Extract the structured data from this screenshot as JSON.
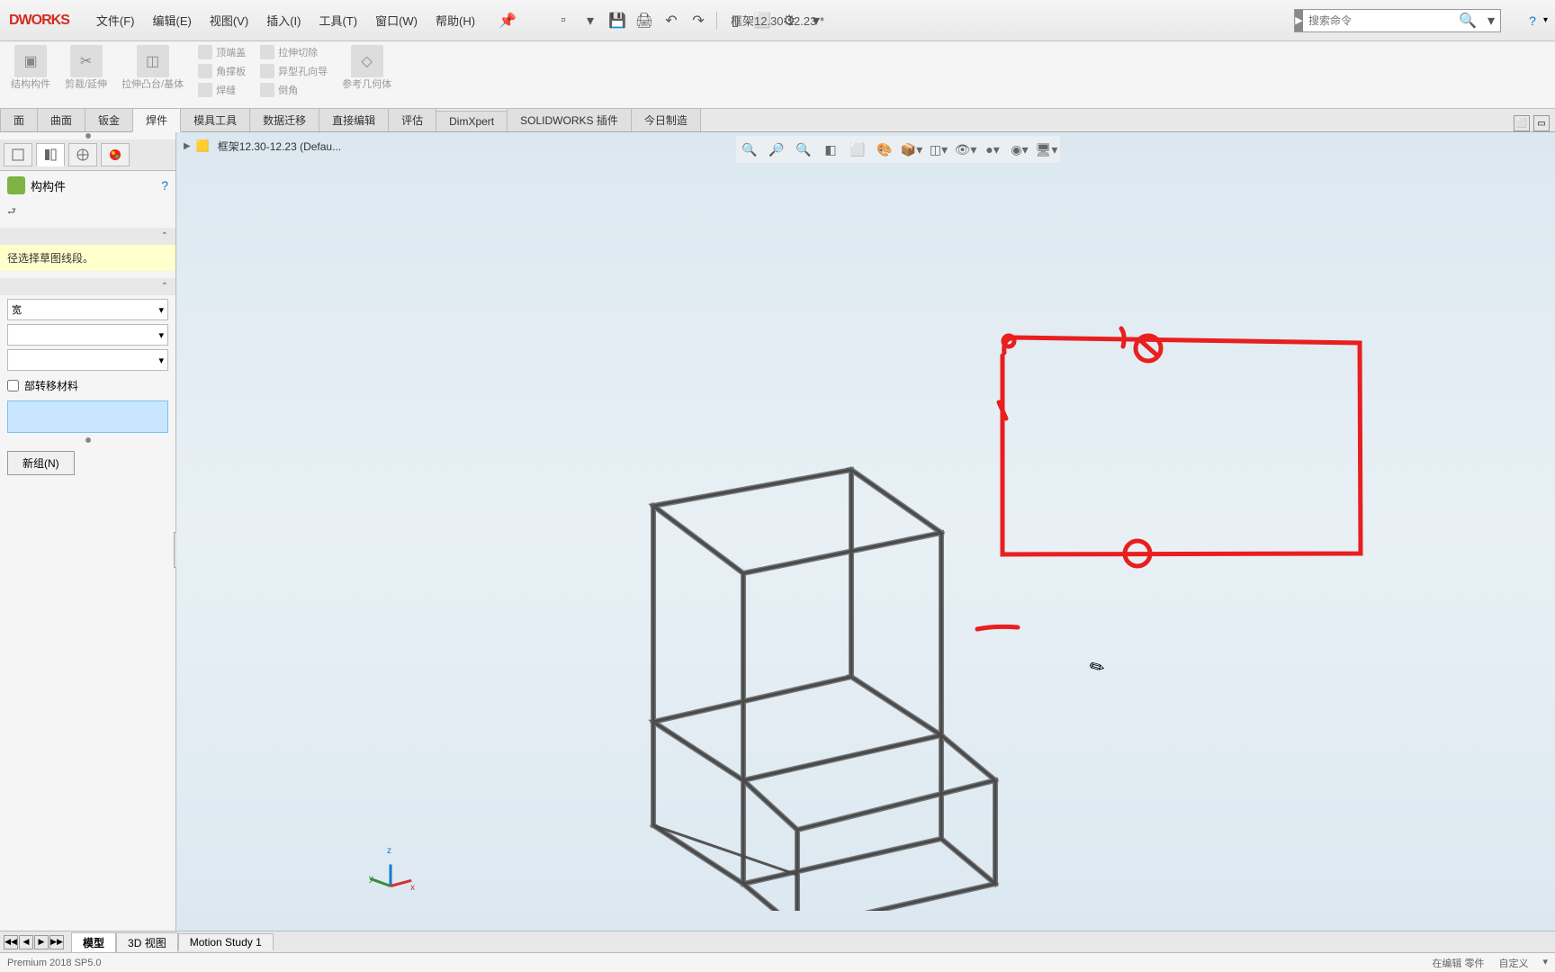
{
  "app": {
    "logo": "DWORKS",
    "doc_title": "框架12.30-12.23 *",
    "search_placeholder": "搜索命令"
  },
  "menu": {
    "file": "文件(F)",
    "edit": "编辑(E)",
    "view": "视图(V)",
    "insert": "插入(I)",
    "tools": "工具(T)",
    "window": "窗口(W)",
    "help": "帮助(H)"
  },
  "ribbon": {
    "structural_member": "结构构件",
    "trim_extend": "剪裁/延伸",
    "extrude_boss": "拉伸凸台/基体",
    "end_cap": "顶端盖",
    "gusset": "角撑板",
    "weld_bead": "焊缝",
    "extrude_cut": "拉伸切除",
    "hole_wizard": "异型孔向导",
    "chamfer": "倒角",
    "ref_geom": "参考几何体"
  },
  "tabs": {
    "items": [
      "面",
      "曲面",
      "钣金",
      "焊件",
      "模具工具",
      "数据迁移",
      "直接编辑",
      "评估",
      "DimXpert",
      "SOLIDWORKS 插件",
      "今日制造"
    ],
    "active_index": 3
  },
  "breadcrumb": {
    "doc": "框架12.30-12.23  (Defau..."
  },
  "panel": {
    "title": "构构件",
    "message": "径选择草图线段。",
    "transfer_material": "部转移材料",
    "new_group": "新组(N)"
  },
  "bottom_tabs": {
    "items": [
      "模型",
      "3D 视图",
      "Motion Study 1"
    ],
    "active_index": 0
  },
  "statusbar": {
    "version": "Premium 2018 SP5.0",
    "editing": "在编辑 零件",
    "custom": "自定义"
  },
  "triad": {
    "x": "x",
    "y": "y",
    "z": "z"
  }
}
